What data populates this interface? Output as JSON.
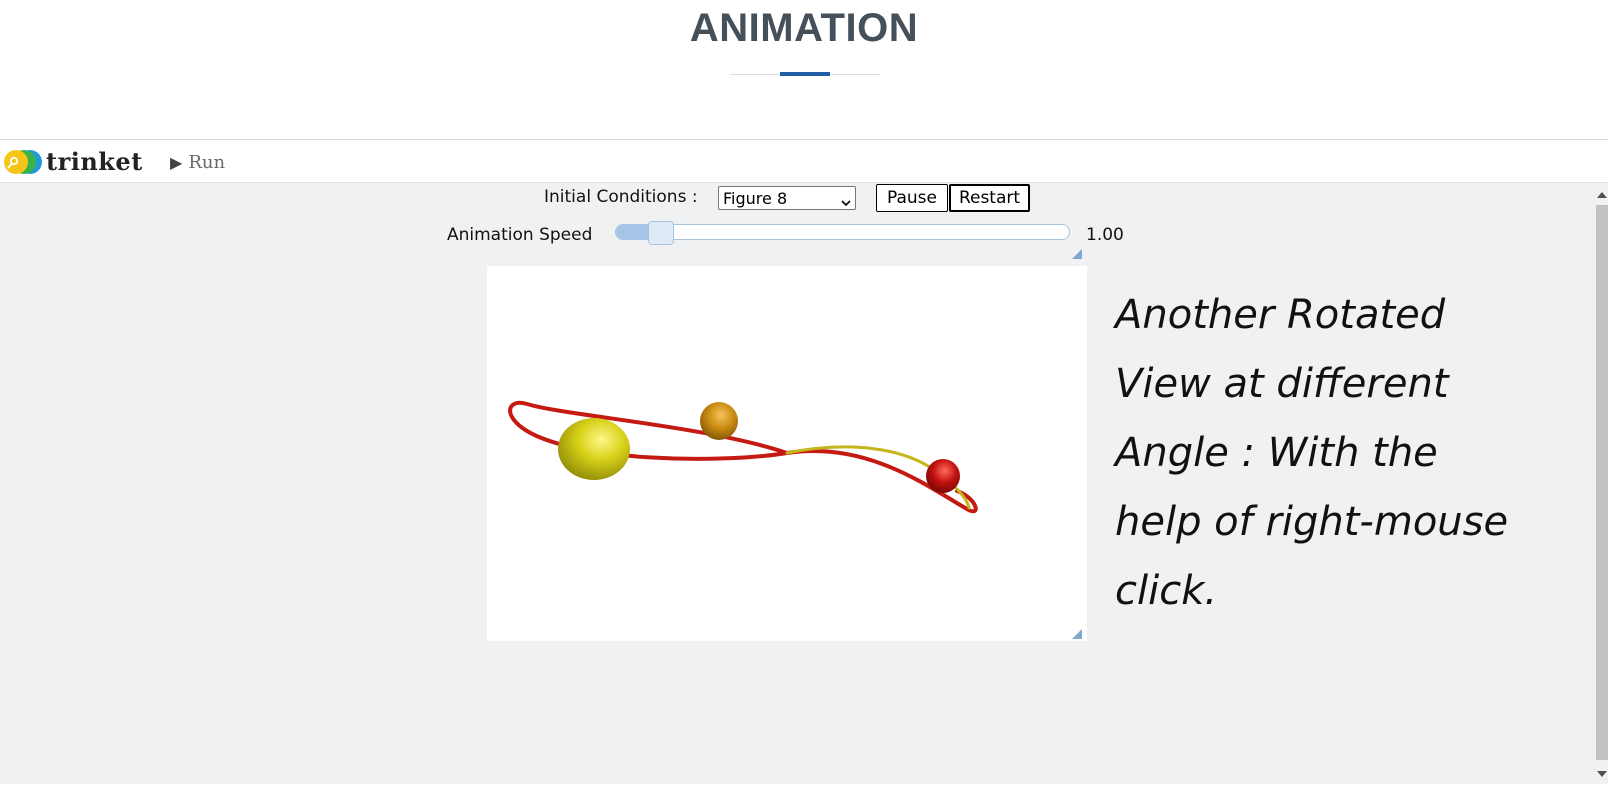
{
  "header": {
    "title": "ANIMATION"
  },
  "trinket": {
    "logo_text": "trinket",
    "run_label": "Run"
  },
  "controls": {
    "initial_conditions_label": "Initial Conditions :",
    "initial_conditions_selected": "Figure 8",
    "pause_label": "Pause",
    "restart_label": "Restart",
    "speed_label": "Animation Speed",
    "speed_value": "1.00",
    "speed_fraction": 0.1
  },
  "caption": {
    "lines": [
      "Another Rotated",
      "View at different",
      "Angle : With the",
      "help of right-mouse",
      "click."
    ]
  },
  "colors": {
    "title": "#46505a",
    "accent": "#1f5fa8",
    "content_bg": "#f0f1f3",
    "orbit_red": "#c41a12",
    "orbit_yellow": "#c6b51a",
    "large_sphere": "#d8d21a",
    "medium_sphere": "#c98a10",
    "small_sphere": "#c01010"
  },
  "icons": {
    "run": "play-icon",
    "select": "chevron-down-icon",
    "logo": "trinket-logo-icon"
  }
}
